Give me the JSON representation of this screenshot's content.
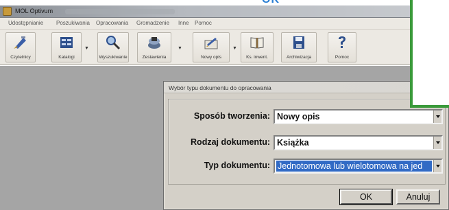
{
  "top_overlay": {
    "text": "OK"
  },
  "window": {
    "title": "MOL Optivum"
  },
  "menu": [
    {
      "label": "Udostępnianie"
    },
    {
      "label": "Poszukiwania"
    },
    {
      "label": "Opracowania"
    },
    {
      "label": "Gromadzenie"
    },
    {
      "label": "Inne"
    },
    {
      "label": "Pomoc"
    }
  ],
  "toolbar": [
    {
      "label": "Czytelnicy",
      "icon": "readers-icon"
    },
    {
      "label": "Katalogi",
      "icon": "catalogs-icon"
    },
    {
      "label": "Wyszukiwanie",
      "icon": "search-icon"
    },
    {
      "label": "Zestawienia",
      "icon": "reports-icon"
    },
    {
      "label": "Nowy opis",
      "icon": "new-description-icon"
    },
    {
      "label": "Ks. inwent.",
      "icon": "inventory-book-icon"
    },
    {
      "label": "Archiwizacja",
      "icon": "save-icon"
    },
    {
      "label": "Pomoc",
      "icon": "help-icon"
    }
  ],
  "dialog": {
    "title": "Wybór typu dokumentu do opracowania",
    "fields": [
      {
        "label": "Sposób tworzenia:",
        "value": "Nowy opis"
      },
      {
        "label": "Rodzaj dokumentu:",
        "value": "Książka"
      },
      {
        "label": "Typ dokumentu:",
        "value": "Jednotomowa lub wielotomowa na jed"
      }
    ],
    "ok_label": "OK",
    "cancel_label": "Anuluj"
  },
  "colors": {
    "highlight": "#316ac5",
    "green_frame": "#3a9a3a",
    "workspace": "#a5a5a5"
  }
}
